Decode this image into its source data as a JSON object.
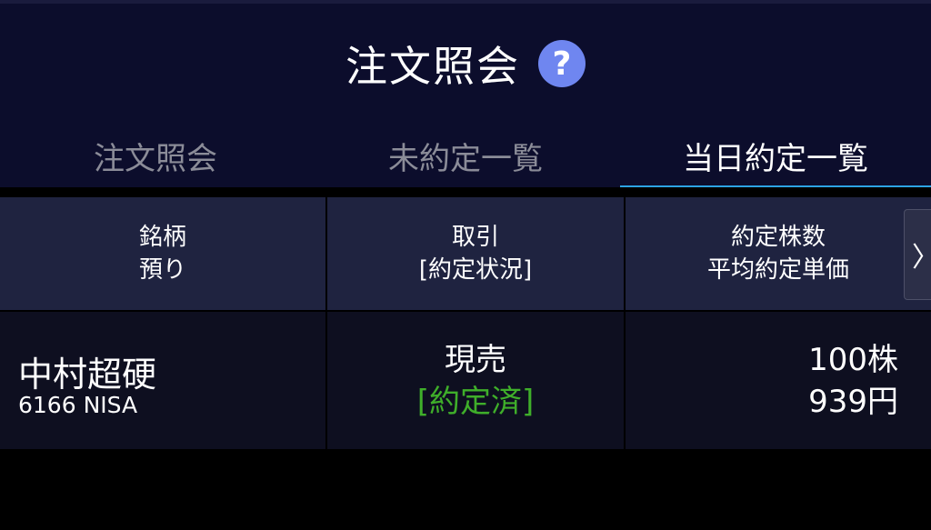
{
  "header": {
    "title": "注文照会",
    "help_label": "?"
  },
  "tabs": [
    {
      "label": "注文照会",
      "active": false
    },
    {
      "label": "未約定一覧",
      "active": false
    },
    {
      "label": "当日約定一覧",
      "active": true
    }
  ],
  "table": {
    "columns": [
      {
        "line1": "銘柄",
        "line2": "預り"
      },
      {
        "line1": "取引",
        "line2": "[約定状況]"
      },
      {
        "line1": "約定株数",
        "line2": "平均約定単価"
      }
    ],
    "next_arrow": "〉",
    "rows": [
      {
        "name": "中村超硬",
        "code_account": "6166 NISA",
        "trade": "現売",
        "status": "[約定済]",
        "quantity": "100株",
        "avg_price": "939円"
      }
    ]
  },
  "colors": {
    "header_bg": "#0c0d2c",
    "active_tab_underline": "#2ca3e4",
    "help_icon_bg": "#6f86f0",
    "status_green": "#3fae2a",
    "table_head_bg": "#1f2340"
  }
}
